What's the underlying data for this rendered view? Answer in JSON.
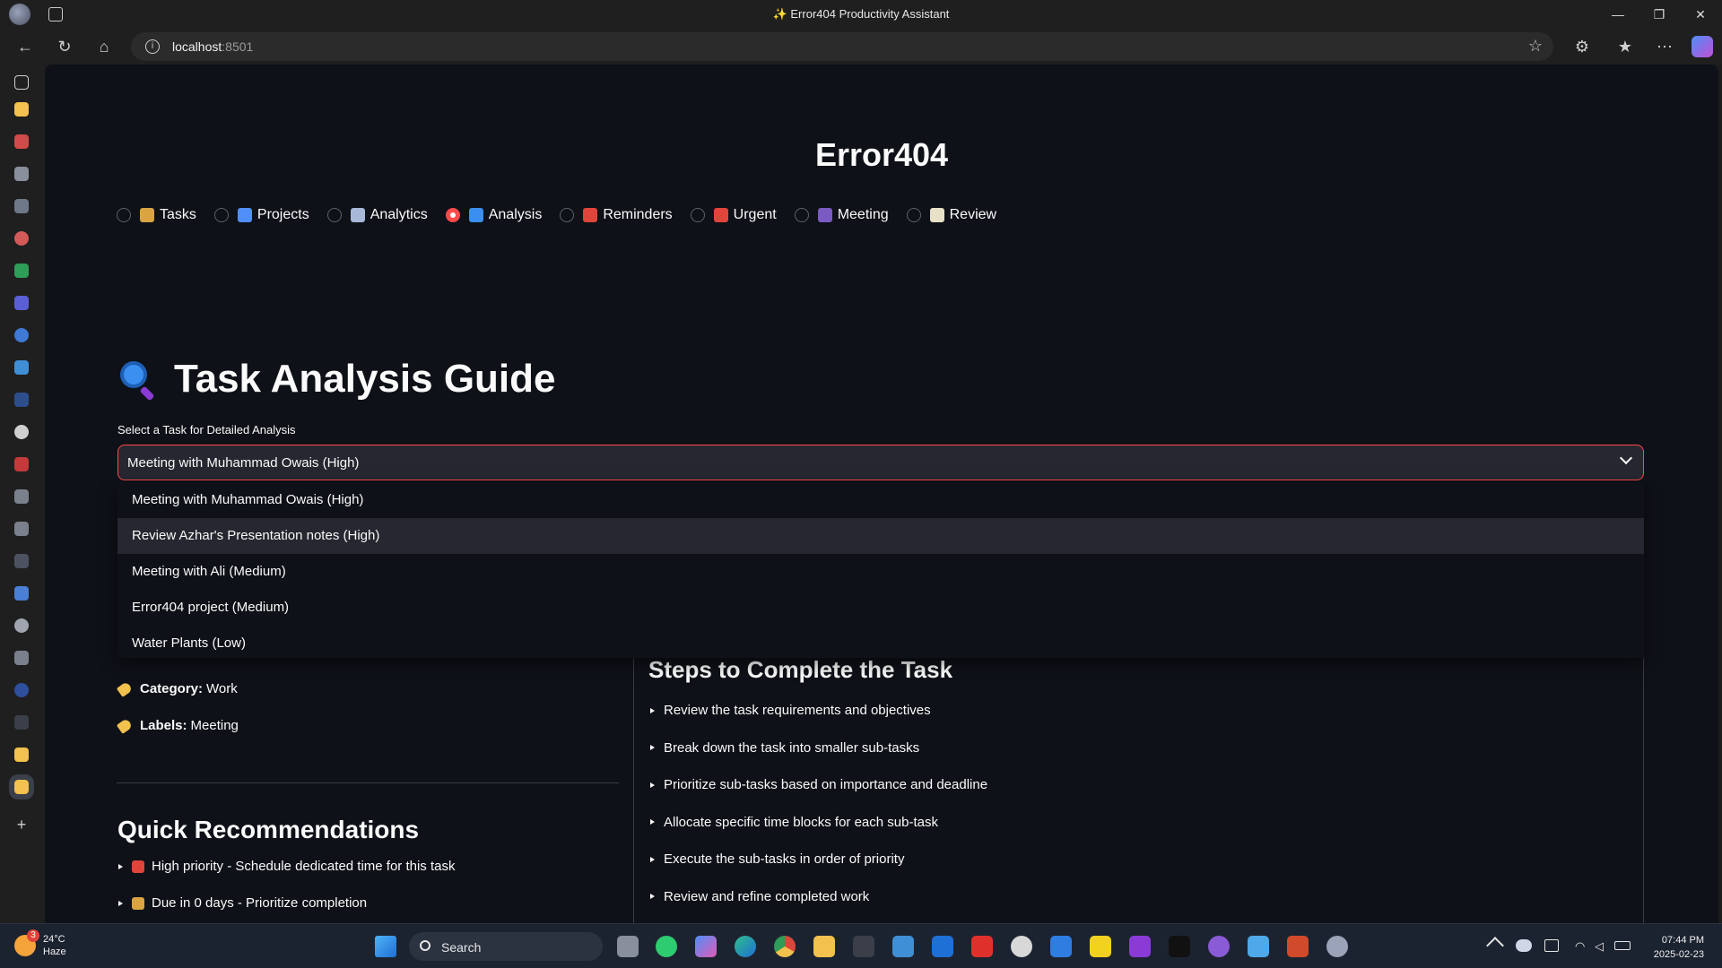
{
  "window": {
    "title": "Error404 Productivity Assistant",
    "title_icon": "sparkles-icon"
  },
  "browser": {
    "url_host": "localhost",
    "url_port": ":8501"
  },
  "app": {
    "title": "Error404",
    "nav_options": [
      {
        "label": "Tasks",
        "icon": "clipboard-icon",
        "color": "#d9a441",
        "selected": false
      },
      {
        "label": "Projects",
        "icon": "bar-chart-icon",
        "color": "#4f8ff7",
        "selected": false
      },
      {
        "label": "Analytics",
        "icon": "trend-chart-icon",
        "color": "#a8b8d8",
        "selected": false
      },
      {
        "label": "Analysis",
        "icon": "magnifier-icon",
        "color": "#3b8ff0",
        "selected": true
      },
      {
        "label": "Reminders",
        "icon": "alarm-clock-icon",
        "color": "#e0453b",
        "selected": false
      },
      {
        "label": "Urgent",
        "icon": "siren-icon",
        "color": "#e0453b",
        "selected": false
      },
      {
        "label": "Meeting",
        "icon": "people-icon",
        "color": "#7a5bc4",
        "selected": false
      },
      {
        "label": "Review",
        "icon": "memo-icon",
        "color": "#e9e0c8",
        "selected": false
      }
    ]
  },
  "analysis": {
    "title": "Task Analysis Guide",
    "select_label": "Select a Task for Detailed Analysis",
    "selected_task": "Meeting with Muhammad Owais (High)",
    "options": [
      "Meeting with Muhammad Owais (High)",
      "Review Azhar's Presentation notes (High)",
      "Meeting with Ali (Medium)",
      "Error404 project (Medium)",
      "Water Plants (Low)"
    ],
    "hovered_option_index": 1,
    "details": {
      "category_label": "Category:",
      "category_value": "Work",
      "labels_label": "Labels:",
      "labels_value": "Meeting"
    },
    "recommendations_title": "Quick Recommendations",
    "recommendations": [
      {
        "text": "High priority - Schedule dedicated time for this task",
        "icon": "siren-icon"
      },
      {
        "text": "Due in 0 days - Prioritize completion",
        "icon": "hourglass-icon"
      }
    ],
    "steps_title": "Steps to Complete the Task",
    "steps": [
      "Review the task requirements and objectives",
      "Break down the task into smaller sub-tasks",
      "Prioritize sub-tasks based on importance and deadline",
      "Allocate specific time blocks for each sub-task",
      "Execute the sub-tasks in order of priority",
      "Review and refine completed work"
    ]
  },
  "taskbar": {
    "weather_temp": "24°C",
    "weather_desc": "Haze",
    "weather_badge": "3",
    "search_label": "Search",
    "time": "07:44 PM",
    "date": "2025-02-23"
  },
  "colors": {
    "accent": "#ff4b4b",
    "page_bg": "#0e1117",
    "widget_bg": "#262730"
  }
}
